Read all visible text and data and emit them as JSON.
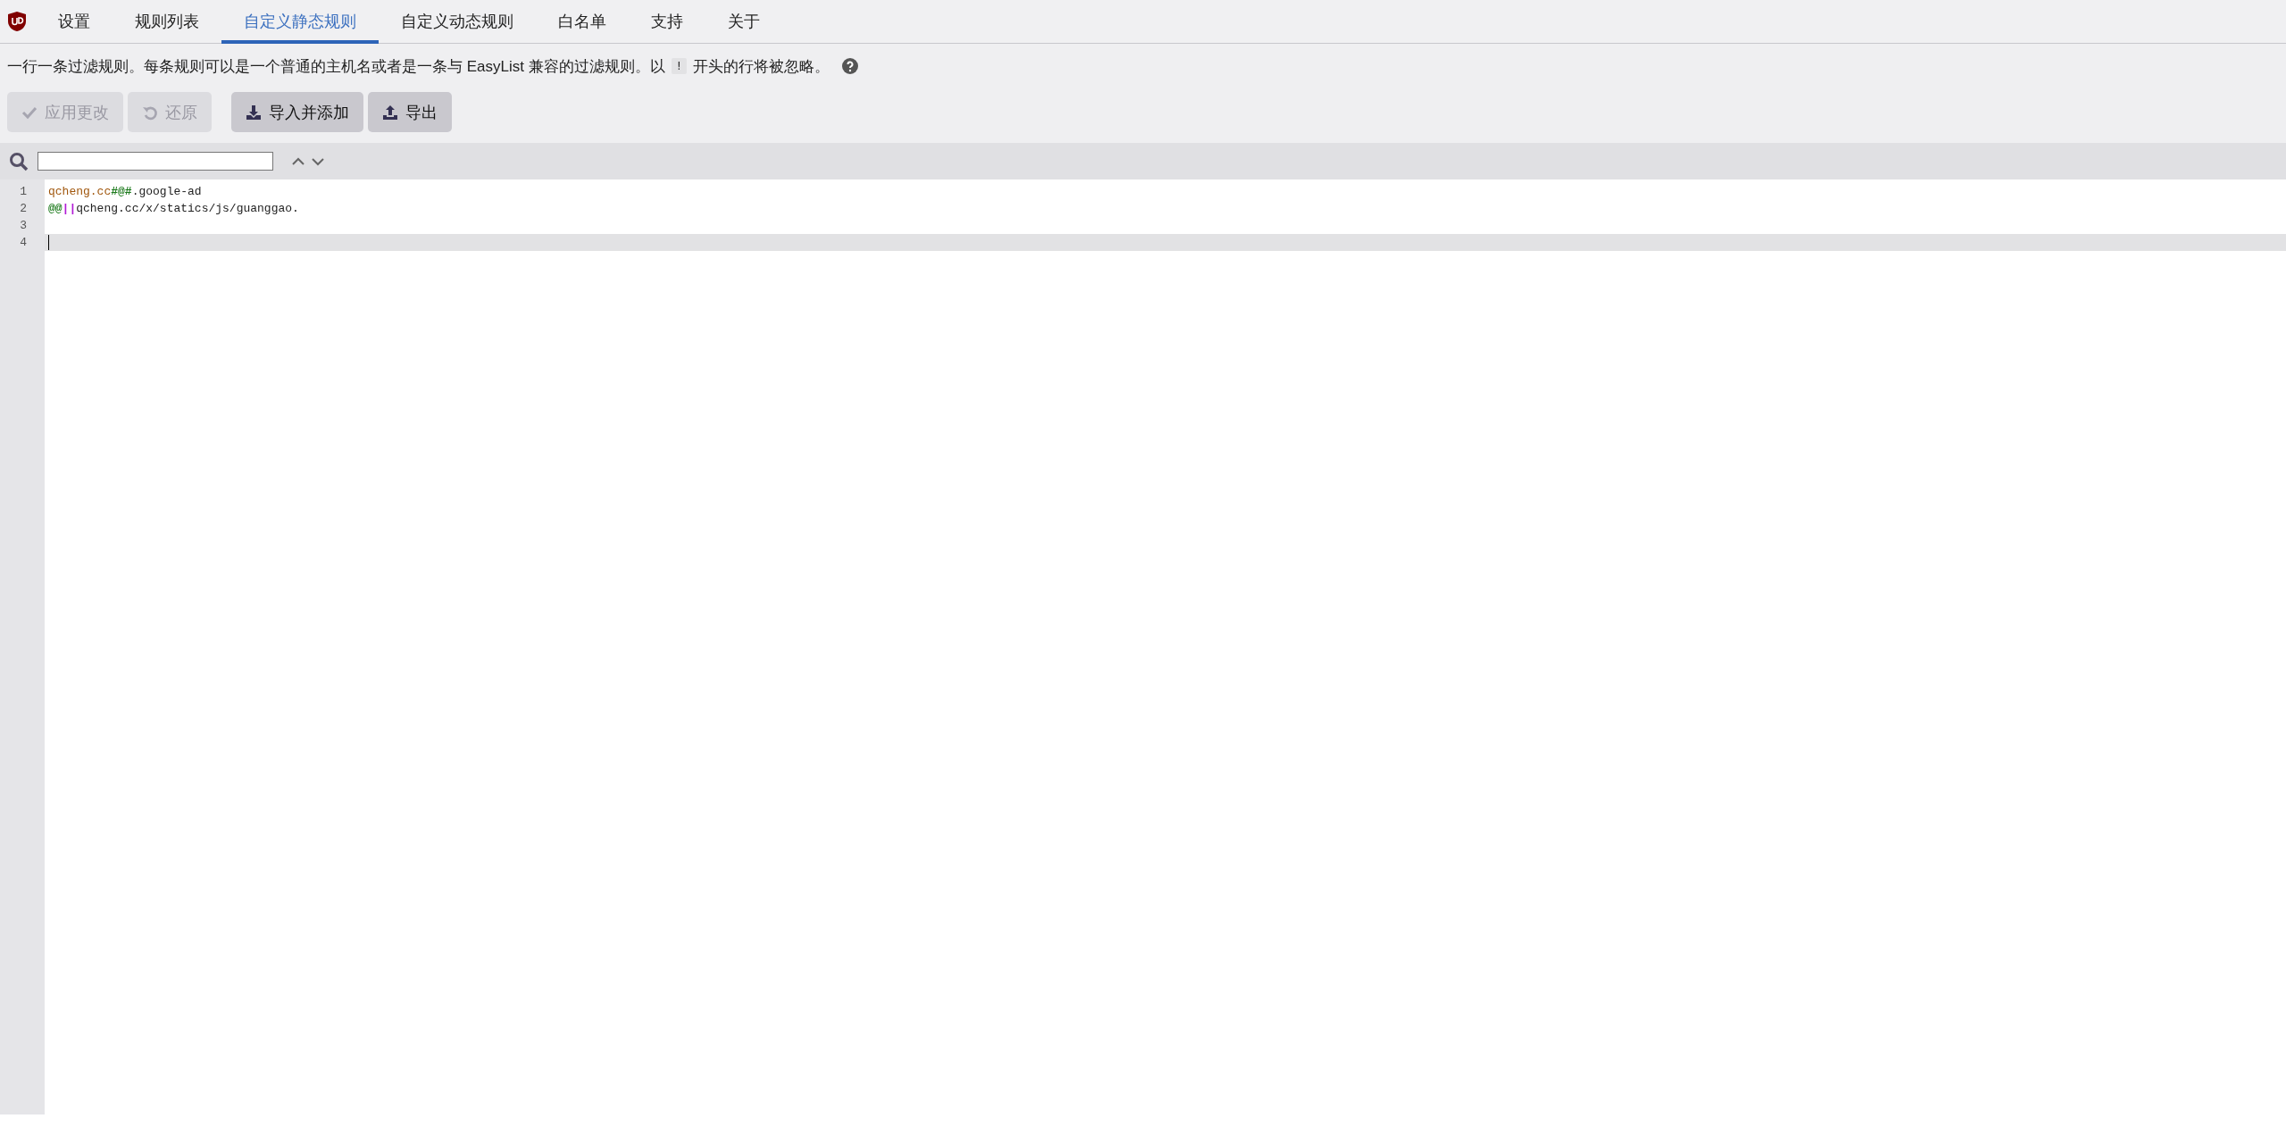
{
  "tabs": [
    {
      "label": "设置",
      "selected": false
    },
    {
      "label": "规则列表",
      "selected": false
    },
    {
      "label": "自定义静态规则",
      "selected": true
    },
    {
      "label": "自定义动态规则",
      "selected": false
    },
    {
      "label": "白名单",
      "selected": false
    },
    {
      "label": "支持",
      "selected": false
    },
    {
      "label": "关于",
      "selected": false
    }
  ],
  "description": {
    "before": "一行一条过滤规则。每条规则可以是一个普通的主机名或者是一条与 EasyList 兼容的过滤规则。以",
    "code": "!",
    "after": "开头的行将被忽略。"
  },
  "buttons": [
    {
      "label": "应用更改",
      "kind": "check",
      "disabled": true
    },
    {
      "label": "还原",
      "kind": "undo",
      "disabled": true
    },
    {
      "label": "导入并添加",
      "kind": "download",
      "disabled": false
    },
    {
      "label": "导出",
      "kind": "upload",
      "disabled": false
    }
  ],
  "editor": {
    "lines": [
      {
        "number": "1",
        "active": false,
        "segments": [
          {
            "text": "qcheng.cc",
            "kind": "domain"
          },
          {
            "text": "#@#",
            "kind": "separator"
          },
          {
            "text": ".google-ad",
            "kind": "plain"
          }
        ]
      },
      {
        "number": "2",
        "active": false,
        "segments": [
          {
            "text": "@@",
            "kind": "separator"
          },
          {
            "text": "||",
            "kind": "anchor"
          },
          {
            "text": "qcheng.cc/x/statics/js/guanggao.",
            "kind": "plain"
          }
        ]
      },
      {
        "number": "3",
        "active": false
      },
      {
        "number": "4",
        "active": true
      }
    ]
  }
}
